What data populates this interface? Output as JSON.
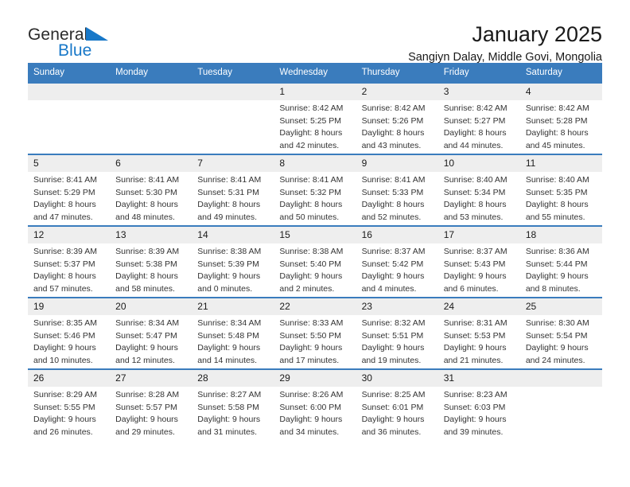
{
  "brand": {
    "name_part1": "General",
    "name_part2": "Blue",
    "accent_color": "#1878c8"
  },
  "header": {
    "title": "January 2025",
    "subtitle": "Sangiyn Dalay, Middle Govi, Mongolia"
  },
  "calendar": {
    "header_bg": "#3a7cbd",
    "daynum_bg": "#eeeeee",
    "weekdays": [
      "Sunday",
      "Monday",
      "Tuesday",
      "Wednesday",
      "Thursday",
      "Friday",
      "Saturday"
    ],
    "weeks": [
      [
        {
          "day": "",
          "lines": []
        },
        {
          "day": "",
          "lines": []
        },
        {
          "day": "",
          "lines": []
        },
        {
          "day": "1",
          "lines": [
            "Sunrise: 8:42 AM",
            "Sunset: 5:25 PM",
            "Daylight: 8 hours",
            "and 42 minutes."
          ]
        },
        {
          "day": "2",
          "lines": [
            "Sunrise: 8:42 AM",
            "Sunset: 5:26 PM",
            "Daylight: 8 hours",
            "and 43 minutes."
          ]
        },
        {
          "day": "3",
          "lines": [
            "Sunrise: 8:42 AM",
            "Sunset: 5:27 PM",
            "Daylight: 8 hours",
            "and 44 minutes."
          ]
        },
        {
          "day": "4",
          "lines": [
            "Sunrise: 8:42 AM",
            "Sunset: 5:28 PM",
            "Daylight: 8 hours",
            "and 45 minutes."
          ]
        }
      ],
      [
        {
          "day": "5",
          "lines": [
            "Sunrise: 8:41 AM",
            "Sunset: 5:29 PM",
            "Daylight: 8 hours",
            "and 47 minutes."
          ]
        },
        {
          "day": "6",
          "lines": [
            "Sunrise: 8:41 AM",
            "Sunset: 5:30 PM",
            "Daylight: 8 hours",
            "and 48 minutes."
          ]
        },
        {
          "day": "7",
          "lines": [
            "Sunrise: 8:41 AM",
            "Sunset: 5:31 PM",
            "Daylight: 8 hours",
            "and 49 minutes."
          ]
        },
        {
          "day": "8",
          "lines": [
            "Sunrise: 8:41 AM",
            "Sunset: 5:32 PM",
            "Daylight: 8 hours",
            "and 50 minutes."
          ]
        },
        {
          "day": "9",
          "lines": [
            "Sunrise: 8:41 AM",
            "Sunset: 5:33 PM",
            "Daylight: 8 hours",
            "and 52 minutes."
          ]
        },
        {
          "day": "10",
          "lines": [
            "Sunrise: 8:40 AM",
            "Sunset: 5:34 PM",
            "Daylight: 8 hours",
            "and 53 minutes."
          ]
        },
        {
          "day": "11",
          "lines": [
            "Sunrise: 8:40 AM",
            "Sunset: 5:35 PM",
            "Daylight: 8 hours",
            "and 55 minutes."
          ]
        }
      ],
      [
        {
          "day": "12",
          "lines": [
            "Sunrise: 8:39 AM",
            "Sunset: 5:37 PM",
            "Daylight: 8 hours",
            "and 57 minutes."
          ]
        },
        {
          "day": "13",
          "lines": [
            "Sunrise: 8:39 AM",
            "Sunset: 5:38 PM",
            "Daylight: 8 hours",
            "and 58 minutes."
          ]
        },
        {
          "day": "14",
          "lines": [
            "Sunrise: 8:38 AM",
            "Sunset: 5:39 PM",
            "Daylight: 9 hours",
            "and 0 minutes."
          ]
        },
        {
          "day": "15",
          "lines": [
            "Sunrise: 8:38 AM",
            "Sunset: 5:40 PM",
            "Daylight: 9 hours",
            "and 2 minutes."
          ]
        },
        {
          "day": "16",
          "lines": [
            "Sunrise: 8:37 AM",
            "Sunset: 5:42 PM",
            "Daylight: 9 hours",
            "and 4 minutes."
          ]
        },
        {
          "day": "17",
          "lines": [
            "Sunrise: 8:37 AM",
            "Sunset: 5:43 PM",
            "Daylight: 9 hours",
            "and 6 minutes."
          ]
        },
        {
          "day": "18",
          "lines": [
            "Sunrise: 8:36 AM",
            "Sunset: 5:44 PM",
            "Daylight: 9 hours",
            "and 8 minutes."
          ]
        }
      ],
      [
        {
          "day": "19",
          "lines": [
            "Sunrise: 8:35 AM",
            "Sunset: 5:46 PM",
            "Daylight: 9 hours",
            "and 10 minutes."
          ]
        },
        {
          "day": "20",
          "lines": [
            "Sunrise: 8:34 AM",
            "Sunset: 5:47 PM",
            "Daylight: 9 hours",
            "and 12 minutes."
          ]
        },
        {
          "day": "21",
          "lines": [
            "Sunrise: 8:34 AM",
            "Sunset: 5:48 PM",
            "Daylight: 9 hours",
            "and 14 minutes."
          ]
        },
        {
          "day": "22",
          "lines": [
            "Sunrise: 8:33 AM",
            "Sunset: 5:50 PM",
            "Daylight: 9 hours",
            "and 17 minutes."
          ]
        },
        {
          "day": "23",
          "lines": [
            "Sunrise: 8:32 AM",
            "Sunset: 5:51 PM",
            "Daylight: 9 hours",
            "and 19 minutes."
          ]
        },
        {
          "day": "24",
          "lines": [
            "Sunrise: 8:31 AM",
            "Sunset: 5:53 PM",
            "Daylight: 9 hours",
            "and 21 minutes."
          ]
        },
        {
          "day": "25",
          "lines": [
            "Sunrise: 8:30 AM",
            "Sunset: 5:54 PM",
            "Daylight: 9 hours",
            "and 24 minutes."
          ]
        }
      ],
      [
        {
          "day": "26",
          "lines": [
            "Sunrise: 8:29 AM",
            "Sunset: 5:55 PM",
            "Daylight: 9 hours",
            "and 26 minutes."
          ]
        },
        {
          "day": "27",
          "lines": [
            "Sunrise: 8:28 AM",
            "Sunset: 5:57 PM",
            "Daylight: 9 hours",
            "and 29 minutes."
          ]
        },
        {
          "day": "28",
          "lines": [
            "Sunrise: 8:27 AM",
            "Sunset: 5:58 PM",
            "Daylight: 9 hours",
            "and 31 minutes."
          ]
        },
        {
          "day": "29",
          "lines": [
            "Sunrise: 8:26 AM",
            "Sunset: 6:00 PM",
            "Daylight: 9 hours",
            "and 34 minutes."
          ]
        },
        {
          "day": "30",
          "lines": [
            "Sunrise: 8:25 AM",
            "Sunset: 6:01 PM",
            "Daylight: 9 hours",
            "and 36 minutes."
          ]
        },
        {
          "day": "31",
          "lines": [
            "Sunrise: 8:23 AM",
            "Sunset: 6:03 PM",
            "Daylight: 9 hours",
            "and 39 minutes."
          ]
        },
        {
          "day": "",
          "lines": []
        }
      ]
    ]
  }
}
